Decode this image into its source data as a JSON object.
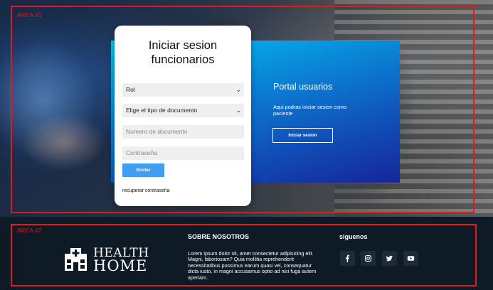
{
  "hero": {
    "area_label": "AREA #1",
    "login": {
      "title_line1": "Iniciar sesion",
      "title_line2": "funcionarios",
      "rol_select": "Rol",
      "doc_type_select": "Elige el tipo de documento",
      "doc_number_placeholder": "Numero de documento",
      "password_placeholder": "Contraseña",
      "submit_label": "Enviar",
      "recover_link": "recuperar contraseña"
    },
    "portal": {
      "title": "Portal usuarios",
      "description": "Aqui podras iniciar sesion como paciente",
      "button_label": "Iniciar sesion"
    }
  },
  "footer": {
    "area_label": "AREA #2",
    "logo_line1": "HEALTH",
    "logo_line2": "HOME",
    "about_title": "SOBRE NOSOTROS",
    "about_text": "Lorem ipsum dolor sit, amet consectetur adipisicing elit. Magni, laboriosam? Quia mollitia reprehenderit necessitatibus possimus earum quasi vel, consequatur dicta iusto, in magni accusamus optio ad nisi fuga autem aperiam.",
    "follow_title": "siguenos",
    "social": [
      "facebook-icon",
      "instagram-icon",
      "twitter-icon",
      "youtube-icon"
    ]
  },
  "colors": {
    "area_outline": "#e01b1b",
    "submit_button": "#3f9df2",
    "portal_gradient_start": "#00c6f2",
    "portal_gradient_end": "#16259a",
    "footer_bg": "#0e1a25"
  }
}
